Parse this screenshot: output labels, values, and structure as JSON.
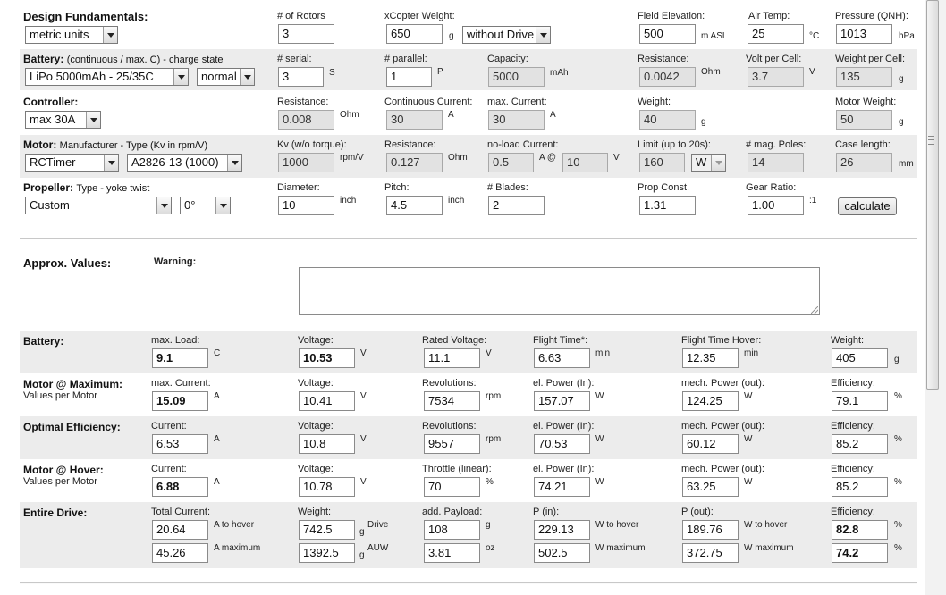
{
  "fundamentals": {
    "title": "Design Fundamentals:",
    "units": "metric units",
    "rotors_label": "# of Rotors",
    "rotors": "3",
    "weight_label": "xCopter Weight:",
    "weight": "650",
    "weight_unit": "g",
    "weight_mode": "without Drive",
    "elevation_label": "Field Elevation:",
    "elevation": "500",
    "elevation_unit": "m ASL",
    "temp_label": "Air Temp:",
    "temp": "25",
    "temp_unit": "°C",
    "pressure_label": "Pressure (QNH):",
    "pressure": "1013",
    "pressure_unit": "hPa"
  },
  "battery": {
    "title": "Battery:",
    "subtitle": "(continuous / max. C) - charge state",
    "type": "LiPo 5000mAh - 25/35C",
    "state": "normal",
    "serial_label": "# serial:",
    "serial": "3",
    "serial_unit": "S",
    "parallel_label": "# parallel:",
    "parallel": "1",
    "parallel_unit": "P",
    "capacity_label": "Capacity:",
    "capacity": "5000",
    "capacity_unit": "mAh",
    "resistance_label": "Resistance:",
    "resistance": "0.0042",
    "resistance_unit": "Ohm",
    "volt_label": "Volt per Cell:",
    "volt": "3.7",
    "volt_unit": "V",
    "cellweight_label": "Weight per Cell:",
    "cellweight": "135",
    "cellweight_unit": "g"
  },
  "controller": {
    "title": "Controller:",
    "type": "max 30A",
    "resistance_label": "Resistance:",
    "resistance": "0.008",
    "resistance_unit": "Ohm",
    "cont_label": "Continuous Current:",
    "cont": "30",
    "cont_unit": "A",
    "max_label": "max. Current:",
    "max": "30",
    "max_unit": "A",
    "weight_label": "Weight:",
    "weight": "40",
    "weight_unit": "g",
    "motorweight_label": "Motor Weight:",
    "motorweight": "50",
    "motorweight_unit": "g"
  },
  "motor": {
    "title": "Motor:",
    "subtitle": "Manufacturer - Type (Kv in rpm/V)",
    "manufacturer": "RCTimer",
    "type": "A2826-13 (1000)",
    "kv_label": "Kv (w/o torque):",
    "kv": "1000",
    "kv_unit": "rpm/V",
    "resistance_label": "Resistance:",
    "resistance": "0.127",
    "resistance_unit": "Ohm",
    "noload_label": "no-load Current:",
    "noload": "0.5",
    "noload_unit": "A @",
    "noload_v": "10",
    "noload_v_unit": "V",
    "limit_label": "Limit (up to 20s):",
    "limit": "160",
    "limit_unit": "W",
    "poles_label": "# mag. Poles:",
    "poles": "14",
    "case_label": "Case length:",
    "case": "26",
    "case_unit": "mm"
  },
  "propeller": {
    "title": "Propeller:",
    "subtitle": "Type - yoke twist",
    "type": "Custom",
    "twist": "0°",
    "diameter_label": "Diameter:",
    "diameter": "10",
    "diameter_unit": "inch",
    "pitch_label": "Pitch:",
    "pitch": "4.5",
    "pitch_unit": "inch",
    "blades_label": "# Blades:",
    "blades": "2",
    "const_label": "Prop Const.",
    "const": "1.31",
    "gear_label": "Gear Ratio:",
    "gear": "1.00",
    "gear_unit": ":1",
    "calculate": "calculate"
  },
  "approx": {
    "title": "Approx. Values:",
    "warning_label": "Warning:"
  },
  "res_battery": {
    "title": "Battery:",
    "load_label": "max. Load:",
    "load": "9.1",
    "load_unit": "C",
    "voltage_label": "Voltage:",
    "voltage": "10.53",
    "voltage_unit": "V",
    "rated_label": "Rated Voltage:",
    "rated": "11.1",
    "rated_unit": "V",
    "flight_label": "Flight Time*:",
    "flight": "6.63",
    "flight_unit": "min",
    "hover_label": "Flight Time Hover:",
    "hover": "12.35",
    "hover_unit": "min",
    "weight_label": "Weight:",
    "weight": "405",
    "weight_unit": "g"
  },
  "res_max": {
    "title": "Motor @ Maximum:",
    "subtitle": "Values per Motor",
    "current_label": "max. Current:",
    "current": "15.09",
    "current_unit": "A",
    "voltage_label": "Voltage:",
    "voltage": "10.41",
    "voltage_unit": "V",
    "rev_label": "Revolutions:",
    "rev": "7534",
    "rev_unit": "rpm",
    "elpower_label": "el. Power (In):",
    "elpower": "157.07",
    "elpower_unit": "W",
    "mech_label": "mech. Power (out):",
    "mech": "124.25",
    "mech_unit": "W",
    "eff_label": "Efficiency:",
    "eff": "79.1",
    "eff_unit": "%"
  },
  "res_opt": {
    "title": "Optimal Efficiency:",
    "current_label": "Current:",
    "current": "6.53",
    "current_unit": "A",
    "voltage_label": "Voltage:",
    "voltage": "10.8",
    "voltage_unit": "V",
    "rev_label": "Revolutions:",
    "rev": "9557",
    "rev_unit": "rpm",
    "elpower_label": "el. Power (In):",
    "elpower": "70.53",
    "elpower_unit": "W",
    "mech_label": "mech. Power (out):",
    "mech": "60.12",
    "mech_unit": "W",
    "eff_label": "Efficiency:",
    "eff": "85.2",
    "eff_unit": "%"
  },
  "res_hover": {
    "title": "Motor @ Hover:",
    "subtitle": "Values per Motor",
    "current_label": "Current:",
    "current": "6.88",
    "current_unit": "A",
    "voltage_label": "Voltage:",
    "voltage": "10.78",
    "voltage_unit": "V",
    "throttle_label": "Throttle (linear):",
    "throttle": "70",
    "throttle_unit": "%",
    "elpower_label": "el. Power (In):",
    "elpower": "74.21",
    "elpower_unit": "W",
    "mech_label": "mech. Power (out):",
    "mech": "63.25",
    "mech_unit": "W",
    "eff_label": "Efficiency:",
    "eff": "85.2",
    "eff_unit": "%"
  },
  "res_drive": {
    "title": "Entire Drive:",
    "current_label": "Total Current:",
    "current_hover": "20.64",
    "current_hover_unit": "A to hover",
    "current_max": "45.26",
    "current_max_unit": "A maximum",
    "weight_label": "Weight:",
    "weight_drive": "742.5",
    "weight_drive_unit": "g",
    "weight_drive_tag": "Drive",
    "weight_auw": "1392.5",
    "weight_auw_unit": "g",
    "weight_auw_tag": "AUW",
    "payload_label": "add. Payload:",
    "payload_g": "108",
    "payload_g_unit": "g",
    "payload_oz": "3.81",
    "payload_oz_unit": "oz",
    "pin_label": "P (in):",
    "pin_hover": "229.13",
    "pin_hover_unit": "W to hover",
    "pin_max": "502.5",
    "pin_max_unit": "W maximum",
    "pout_label": "P (out):",
    "pout_hover": "189.76",
    "pout_hover_unit": "W to hover",
    "pout_max": "372.75",
    "pout_max_unit": "W maximum",
    "eff_label": "Efficiency:",
    "eff_hover": "82.8",
    "eff_hover_unit": "%",
    "eff_max": "74.2",
    "eff_max_unit": "%"
  }
}
